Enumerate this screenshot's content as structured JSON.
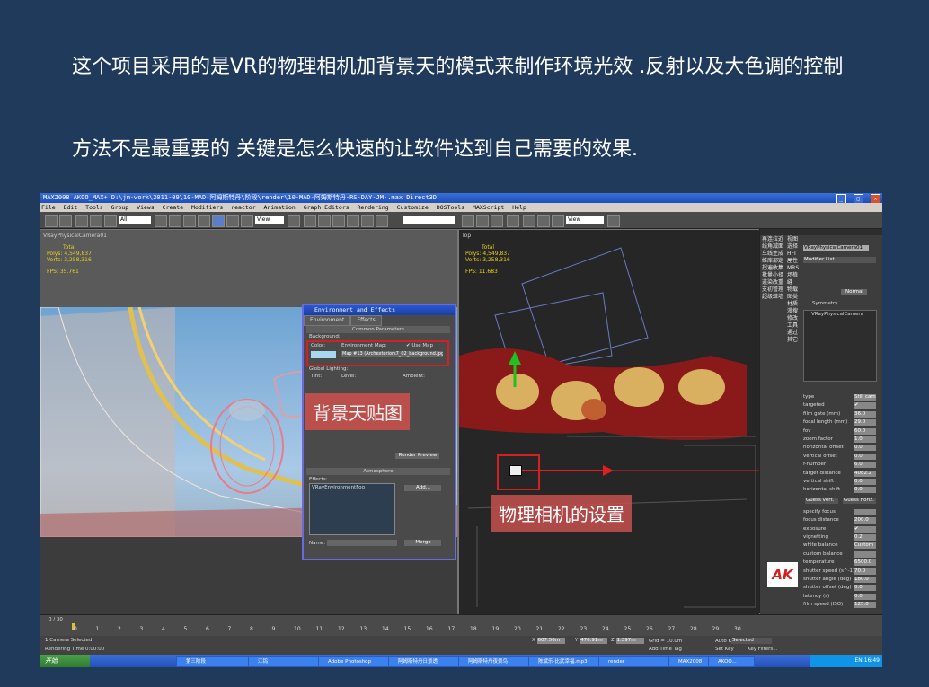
{
  "slide": {
    "line1": "这个项目采用的是VR的物理相机加背景天的模式来制作环境光效 .反射以及大色调的控制",
    "line2": "方法不是最重要的 关键是怎么快速的让软件达到自己需要的效果."
  },
  "app": {
    "title": "MAX2008      AKOO_MAX+      D:\\jm-work\\2011-09\\10-MAD-阿姆斯特丹\\阶段\\render\\10-MAD-阿姆斯特丹-RS-DAY-JM-.max      Direct3D",
    "menus": [
      "File",
      "Edit",
      "Tools",
      "Group",
      "Views",
      "Create",
      "Modifiers",
      "reactor",
      "Animation",
      "Graph Editors",
      "Rendering",
      "Customize",
      "DOSTools",
      "MAXScript",
      "Help"
    ],
    "toolbar_dropdowns": [
      "All",
      "View",
      "View"
    ]
  },
  "viewport_left": {
    "label": "VRayPhysicalCamera01",
    "stats": {
      "total": "Total",
      "polys_label": "Polys:",
      "polys": "4,549,837",
      "verts_label": "Verts:",
      "verts": "3,258,316",
      "fps_label": "FPS:",
      "fps": "35.761"
    }
  },
  "viewport_right": {
    "label": "Top",
    "stats": {
      "total": "Total",
      "polys_label": "Polys:",
      "polys": "4,549,837",
      "verts_label": "Verts:",
      "verts": "3,258,316",
      "fps_label": "FPS:",
      "fps": "11.683"
    }
  },
  "env_dialog": {
    "title": "Environment and Effects",
    "tabs": [
      "Environment",
      "Effects"
    ],
    "common_params": "Common Parameters",
    "background": "Background:",
    "color": "Color:",
    "env_map": "Environment Map:",
    "use_map": "Use Map",
    "map_name": "Map #13 (Archexteriors7_02_background.jpg)",
    "global_lighting": "Global Lighting:",
    "tint": "Tint:",
    "level": "Level:",
    "ambient": "Ambient:",
    "render_preview": "Render Preview",
    "atmosphere": "Atmosphere",
    "effects": "Effects:",
    "effect_item": "VRayEnvironmentFog",
    "add": "Add...",
    "name": "Name:",
    "merge": "Merge"
  },
  "callouts": {
    "bg": "背景天贴图",
    "cam": "物理相机的设置"
  },
  "command_panel": {
    "chinese_menu": [
      "再连拉近",
      "线角减面",
      "车线生成",
      "维库部定",
      "拐遍收集",
      "批量小择",
      "道染改重",
      "支初管理",
      "超级肆墙"
    ],
    "chinese_menu2": [
      "视图",
      "选择",
      "HFI",
      "屋性",
      "MRS",
      "场植",
      "缝",
      "物载",
      "图类",
      "材质",
      "漫搜",
      "修改",
      "工具",
      "通过",
      "其它"
    ],
    "object_name": "VRayPhysicalCamera01",
    "modifier_list": "Modifier List",
    "normal": "Normal",
    "symmetry": "Symmetry",
    "stack_item": "VRayPhysicalCamera",
    "params": [
      {
        "label": "type",
        "value": "Still cam"
      },
      {
        "label": "targeted",
        "value": "✔"
      },
      {
        "label": "film gate (mm)",
        "value": "36.0"
      },
      {
        "label": "focal length (mm)",
        "value": "29.0"
      },
      {
        "label": "fov",
        "value": "60.0"
      },
      {
        "label": "zoom factor",
        "value": "1.0"
      },
      {
        "label": "horizontal offset",
        "value": "0.0"
      },
      {
        "label": "vertical offset",
        "value": "0.0"
      },
      {
        "label": "f-number",
        "value": "6.0"
      },
      {
        "label": "target distance",
        "value": "4082.2"
      },
      {
        "label": "vertical shift",
        "value": "0.0"
      },
      {
        "label": "horizontal shift",
        "value": "0.0"
      }
    ],
    "guess_vert": "Guess vert.",
    "guess_horiz": "Guess horiz.",
    "params2": [
      {
        "label": "specify focus",
        "value": ""
      },
      {
        "label": "focus distance",
        "value": "200.0"
      },
      {
        "label": "exposure",
        "value": "✔"
      },
      {
        "label": "vignetting",
        "value": "0.2"
      },
      {
        "label": "white balance",
        "value": "Custom"
      },
      {
        "label": "custom balance",
        "value": ""
      },
      {
        "label": "temperature",
        "value": "6500.0"
      },
      {
        "label": "shutter speed (s^-1)",
        "value": "70.0"
      },
      {
        "label": "shutter angle (deg)",
        "value": "180.0"
      },
      {
        "label": "shutter offset (deg)",
        "value": "0.0"
      },
      {
        "label": "latency (s)",
        "value": "0.0"
      },
      {
        "label": "film speed (ISO)",
        "value": "125.0"
      }
    ],
    "bottom_labels": [
      "设置",
      "鼓载",
      "帮助"
    ]
  },
  "timeline": {
    "frame": "0 / 30",
    "ticks": [
      "0",
      "1",
      "2",
      "3",
      "4",
      "5",
      "6",
      "7",
      "8",
      "9",
      "10",
      "11",
      "12",
      "13",
      "14",
      "15",
      "16",
      "17",
      "18",
      "19",
      "20",
      "21",
      "22",
      "23",
      "24",
      "25",
      "26",
      "27",
      "28",
      "29",
      "30"
    ]
  },
  "status": {
    "selected": "1 Camera Selected",
    "rendering_time": "Rendering Time  0:00:00",
    "x": "607.56m",
    "y": "476.91m",
    "z": "1.397m",
    "grid": "Grid = 10.0m",
    "add_time_tag": "Add Time Tag",
    "auto_key": "Auto Key",
    "set_key": "Set Key",
    "selected_dd": "Selected",
    "key_filters": "Key Filters..."
  },
  "taskbar": {
    "start": "开始",
    "tasks": [
      "第三阶段",
      "江钨",
      "Adobe Photoshop",
      "阿姆斯特丹日景透",
      "阿姆斯特丹夜景鸟",
      "陈斌乐-比武幸福.mp3",
      "render",
      "MAX2008",
      "AKOO..."
    ],
    "clock": "EN  16:49"
  },
  "colors": {
    "slide_bg": "#1f3a5a",
    "callout_bg": "#c0504d",
    "highlight_red": "#d42020"
  }
}
